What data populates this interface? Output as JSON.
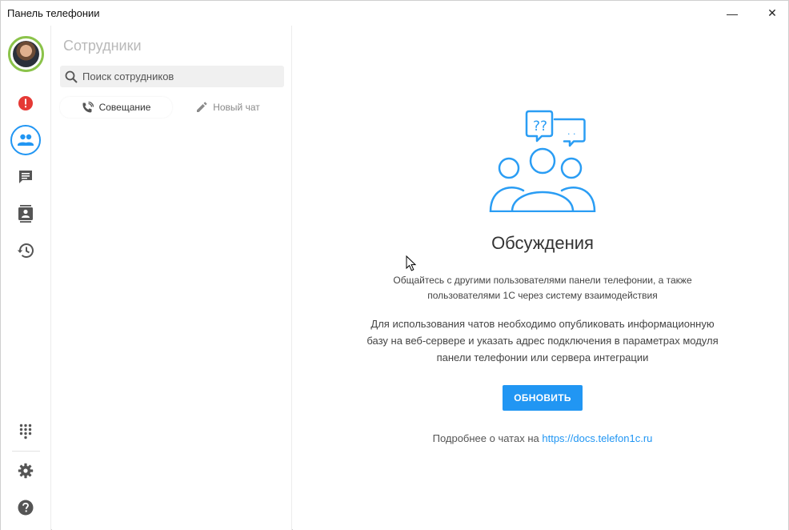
{
  "window": {
    "title": "Панель телефонии",
    "minimize_glyph": "—",
    "close_glyph": "✕"
  },
  "rail": {
    "items": [
      {
        "name": "alert",
        "icon": "alert-icon",
        "color": "#e53935"
      },
      {
        "name": "employees",
        "icon": "people-icon",
        "color": "#2196f3",
        "active": true
      },
      {
        "name": "chats",
        "icon": "chat-icon",
        "color": "#555555"
      },
      {
        "name": "contacts",
        "icon": "contacts-icon",
        "color": "#555555"
      },
      {
        "name": "history",
        "icon": "history-icon",
        "color": "#555555"
      }
    ],
    "bottom": [
      {
        "name": "dialpad",
        "icon": "dialpad-icon"
      },
      {
        "name": "settings",
        "icon": "gear-icon"
      },
      {
        "name": "help",
        "icon": "help-icon"
      }
    ]
  },
  "panel": {
    "title": "Сотрудники",
    "search_placeholder": "Поиск сотрудников",
    "conference_label": "Совещание",
    "new_chat_label": "Новый чат"
  },
  "main": {
    "heading": "Обсуждения",
    "description_line1": "Общайтесь с другими пользователями панели телефонии, а также",
    "description_line2": "пользователями 1С через систему взаимодействия",
    "info_line1": "Для использования чатов необходимо опубликовать информационную",
    "info_line2": "базу на веб-сервере и указать адрес подключения в параметрах модуля",
    "info_line3": "панели телефонии или сервера интеграции",
    "refresh_label": "ОБНОВИТЬ",
    "more_prefix": "Подробнее о чатах на",
    "more_link": "https://docs.telefon1c.ru"
  },
  "colors": {
    "accent": "#2196f3",
    "avatar_ring": "#8bc34a",
    "alert": "#e53935"
  }
}
